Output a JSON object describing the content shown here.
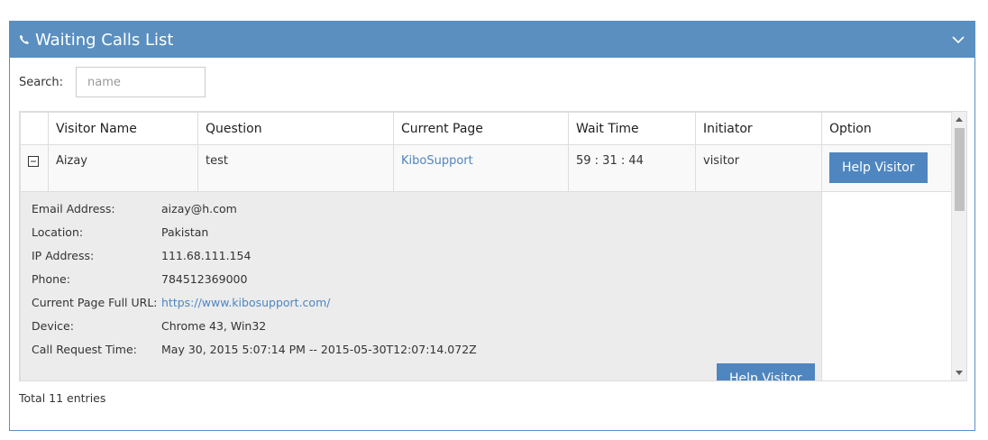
{
  "panel": {
    "title": "Waiting Calls List"
  },
  "search": {
    "label": "Search:",
    "placeholder": "name",
    "value": ""
  },
  "table": {
    "columns": [
      "Visitor Name",
      "Question",
      "Current Page",
      "Wait Time",
      "Initiator",
      "Option"
    ],
    "rows": [
      {
        "visitor_name": "Aizay",
        "question": "test",
        "current_page": "KiboSupport",
        "wait_time": "59 : 31 : 44",
        "initiator": "visitor",
        "option_label": "Help Visitor"
      }
    ],
    "details": {
      "fields": [
        {
          "label": "Email Address:",
          "value": "aizay@h.com"
        },
        {
          "label": "Location:",
          "value": "Pakistan"
        },
        {
          "label": "IP Address:",
          "value": "111.68.111.154"
        },
        {
          "label": "Phone:",
          "value": "784512369000"
        },
        {
          "label": "Current Page Full URL:",
          "value": "https://www.kibosupport.com/"
        },
        {
          "label": "Device:",
          "value": "Chrome 43, Win32"
        },
        {
          "label": "Call Request Time:",
          "value": "May 30, 2015 5:07:14 PM -- 2015-05-30T12:07:14.072Z"
        }
      ],
      "button_label": "Help Visitor"
    }
  },
  "footer": {
    "total": "Total 11 entries"
  },
  "colors": {
    "header": "#5a8fc0",
    "link": "#4f86bf",
    "button": "#4f86bf"
  }
}
